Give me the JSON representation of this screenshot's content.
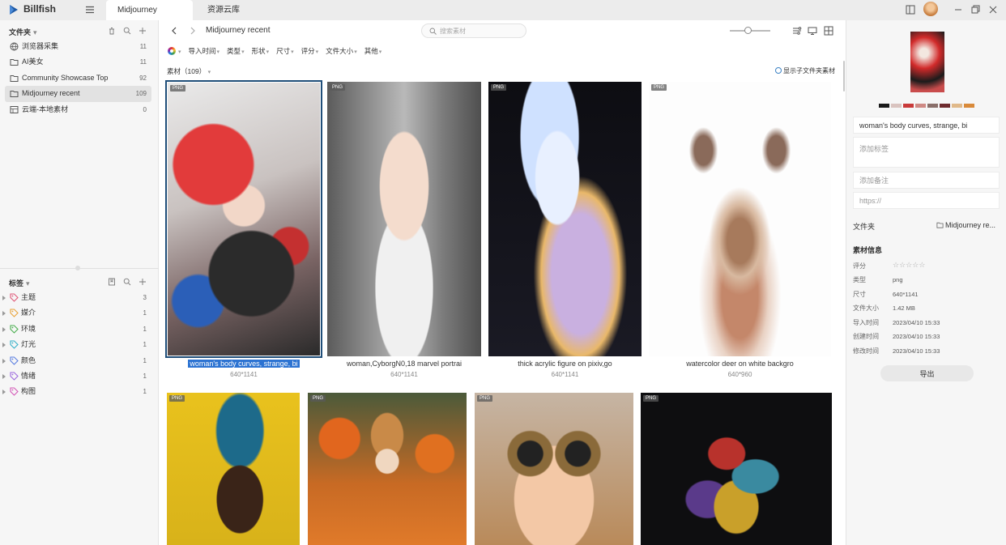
{
  "titlebar": {
    "app_name": "Billfish",
    "tabs": [
      {
        "label": "Midjourney",
        "active": true
      },
      {
        "label": "资源云库",
        "active": false
      }
    ]
  },
  "sidebar": {
    "folders_title": "文件夹",
    "folders": [
      {
        "label": "浏览器采集",
        "count": "11",
        "icon": "globe-icon"
      },
      {
        "label": "AI美女",
        "count": "11",
        "icon": "folder-icon"
      },
      {
        "label": "Community Showcase Top",
        "count": "92",
        "icon": "folder-icon"
      },
      {
        "label": "Midjourney recent",
        "count": "109",
        "icon": "folder-icon",
        "selected": true
      },
      {
        "label": "云端-本地素材",
        "count": "0",
        "icon": "grid-folder-icon"
      }
    ],
    "tags_title": "标签",
    "tags": [
      {
        "label": "主题",
        "count": "3",
        "color": "#e05a7a"
      },
      {
        "label": "媒介",
        "count": "1",
        "color": "#e8a33a"
      },
      {
        "label": "环境",
        "count": "1",
        "color": "#4caf50"
      },
      {
        "label": "灯光",
        "count": "1",
        "color": "#38b2c9"
      },
      {
        "label": "颜色",
        "count": "1",
        "color": "#5b7fe0"
      },
      {
        "label": "情绪",
        "count": "1",
        "color": "#9c6ade"
      },
      {
        "label": "构图",
        "count": "1",
        "color": "#d45ab8"
      }
    ]
  },
  "main": {
    "breadcrumb": "Midjourney recent",
    "search_placeholder": "搜索素材",
    "filters": [
      "导入时间",
      "类型",
      "形状",
      "尺寸",
      "评分",
      "文件大小",
      "其他"
    ],
    "count_label": "素材（109）",
    "show_subfolder": "显示子文件夹素材",
    "items": [
      {
        "type": "PNG",
        "caption": "woman's body curves, strange, bi",
        "dims": "640*1141",
        "selected": true
      },
      {
        "type": "PNG",
        "caption": "woman,CyborgN0,18 marvel portrai",
        "dims": "640*1141"
      },
      {
        "type": "PNG",
        "caption": "thick acrylic figure on pixiv,go",
        "dims": "640*1141"
      },
      {
        "type": "PNG",
        "caption": "watercolor deer on white backgro",
        "dims": "640*960"
      },
      {
        "type": "PNG"
      },
      {
        "type": "PNG"
      },
      {
        "type": "PNG"
      },
      {
        "type": "PNG"
      }
    ]
  },
  "inspector": {
    "palette": [
      "#1a1a1a",
      "#d9c3bf",
      "#c93a3a",
      "#cf8a85",
      "#8a6f6a",
      "#6e2b2e",
      "#e0b98a",
      "#d98a3a"
    ],
    "title_value": "woman's body curves, strange, bi",
    "tags_placeholder": "添加标签",
    "note_placeholder": "添加备注",
    "url_placeholder": "https://",
    "folder_label": "文件夹",
    "folder_value": "Midjourney re...",
    "info_title": "素材信息",
    "info": [
      {
        "label": "评分",
        "value": ""
      },
      {
        "label": "类型",
        "value": "png"
      },
      {
        "label": "尺寸",
        "value": "640*1141"
      },
      {
        "label": "文件大小",
        "value": "1.42 MB"
      },
      {
        "label": "导入时间",
        "value": "2023/04/10 15:33"
      },
      {
        "label": "创建时间",
        "value": "2023/04/10 15:33"
      },
      {
        "label": "修改时间",
        "value": "2023/04/10 15:33"
      }
    ],
    "export_label": "导出"
  }
}
